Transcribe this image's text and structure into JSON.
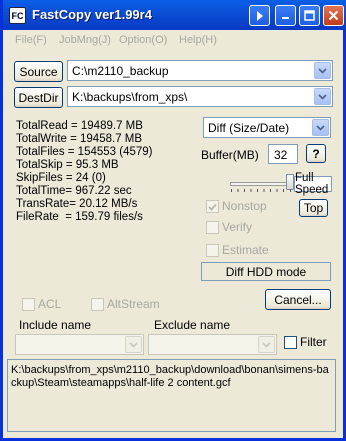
{
  "window": {
    "title": "FastCopy ver1.99r4",
    "icon_text": "FC"
  },
  "title_buttons": {
    "help": "?",
    "minimize": "_",
    "maximize": "□",
    "close": "✕"
  },
  "menu": {
    "items": [
      "File(F)",
      "JobMng(J)",
      "Option(O)",
      "Help(H)"
    ]
  },
  "source": {
    "button_label": "Source",
    "value": "C:\\m2110_backup"
  },
  "destination": {
    "button_label": "DestDir",
    "value": "K:\\backups\\from_xps\\"
  },
  "mode": {
    "selected": "Diff (Size/Date)"
  },
  "stats": {
    "total_read": "TotalRead = 19489.7 MB",
    "total_write": "TotalWrite = 19458.7 MB",
    "total_files": "TotalFiles = 154553 (4579)",
    "total_skip": "TotalSkip = 95.3 MB",
    "skip_files": "SkipFiles = 24 (0)",
    "total_time": "TotalTime= 967.22 sec",
    "trans_rate": "TransRate= 20.12 MB/s",
    "file_rate": "FileRate  = 159.79 files/s"
  },
  "buffer": {
    "label": "Buffer(MB)",
    "value": "32",
    "help": "?"
  },
  "speed": {
    "label": "Full Speed",
    "level": 1.0
  },
  "options": {
    "nonstop": {
      "label": "Nonstop",
      "checked": true
    },
    "verify": {
      "label": "Verify",
      "checked": false
    },
    "estimate": {
      "label": "Estimate",
      "checked": false
    },
    "top_button": "Top",
    "diff_hdd": "Diff HDD mode"
  },
  "cancel_button": "Cancel...",
  "extras": {
    "acl": {
      "label": "ACL",
      "checked": false
    },
    "altstream": {
      "label": "AltStream",
      "checked": false
    }
  },
  "filters": {
    "include_label": "Include name",
    "exclude_label": "Exclude name",
    "filter_label": "Filter",
    "filter_checked": false
  },
  "log": {
    "text": "K:\\backups\\from_xps\\m2110_backup\\download\\bonan\\simens-backup\\Steam\\steamapps\\half-life 2 content.gcf"
  },
  "colors": {
    "title_bar": "#0b4fd6",
    "frame": "#0831d9",
    "face": "#ece9d8",
    "disabled_text": "#a8a8a0"
  }
}
